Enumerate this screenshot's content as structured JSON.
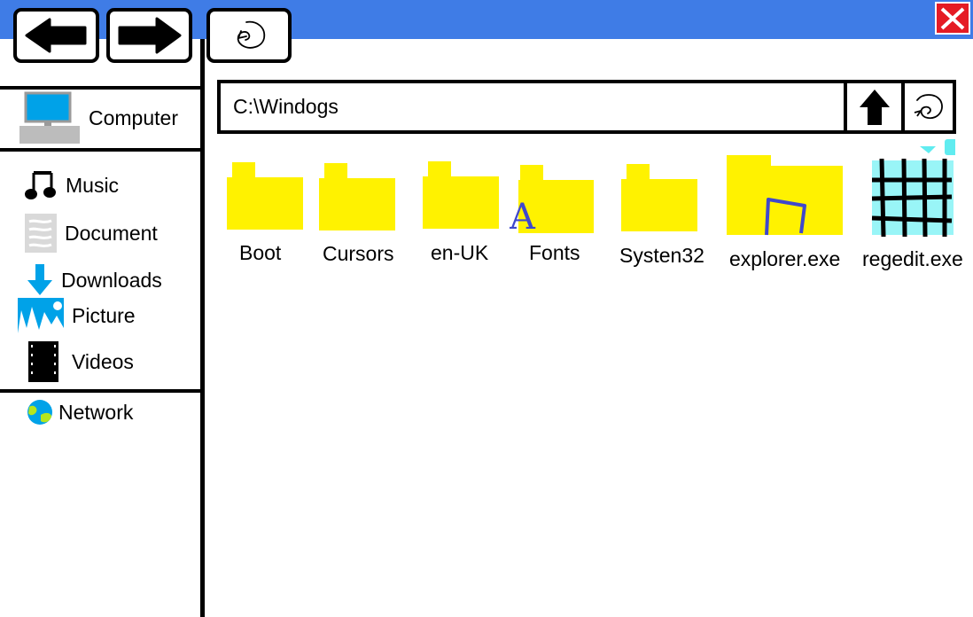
{
  "window": {
    "titlebar_color": "#3f7ce6",
    "close_color": "#e51b24"
  },
  "toolbar": {
    "back_icon": "arrow-left-icon",
    "forward_icon": "arrow-right-icon",
    "refresh_icon": "refresh-swirl-icon"
  },
  "sidebar": {
    "computer": "Computer",
    "libraries": [
      {
        "label": "Music",
        "icon": "music-note-icon"
      },
      {
        "label": "Document",
        "icon": "document-icon"
      },
      {
        "label": "Downloads",
        "icon": "download-arrow-icon"
      },
      {
        "label": "Picture",
        "icon": "picture-icon"
      },
      {
        "label": "Videos",
        "icon": "film-icon"
      }
    ],
    "network": "Network"
  },
  "address": {
    "path": "C:\\Windogs",
    "up_icon": "arrow-up-icon",
    "refresh_icon": "refresh-swirl-icon"
  },
  "files": [
    {
      "name": "Boot",
      "type": "folder"
    },
    {
      "name": "Cursors",
      "type": "folder"
    },
    {
      "name": "en-UK",
      "type": "folder"
    },
    {
      "name": "Fonts",
      "type": "folder-fonts"
    },
    {
      "name": "Systen32",
      "type": "folder"
    },
    {
      "name": "explorer.exe",
      "type": "exe-explorer"
    },
    {
      "name": "regedit.exe",
      "type": "exe-regedit"
    }
  ],
  "colors": {
    "folder": "#fff200",
    "accent_blue": "#00a2e8",
    "regedit_cyan": "#99f5f7",
    "explorer_stroke": "#3f48cc"
  }
}
